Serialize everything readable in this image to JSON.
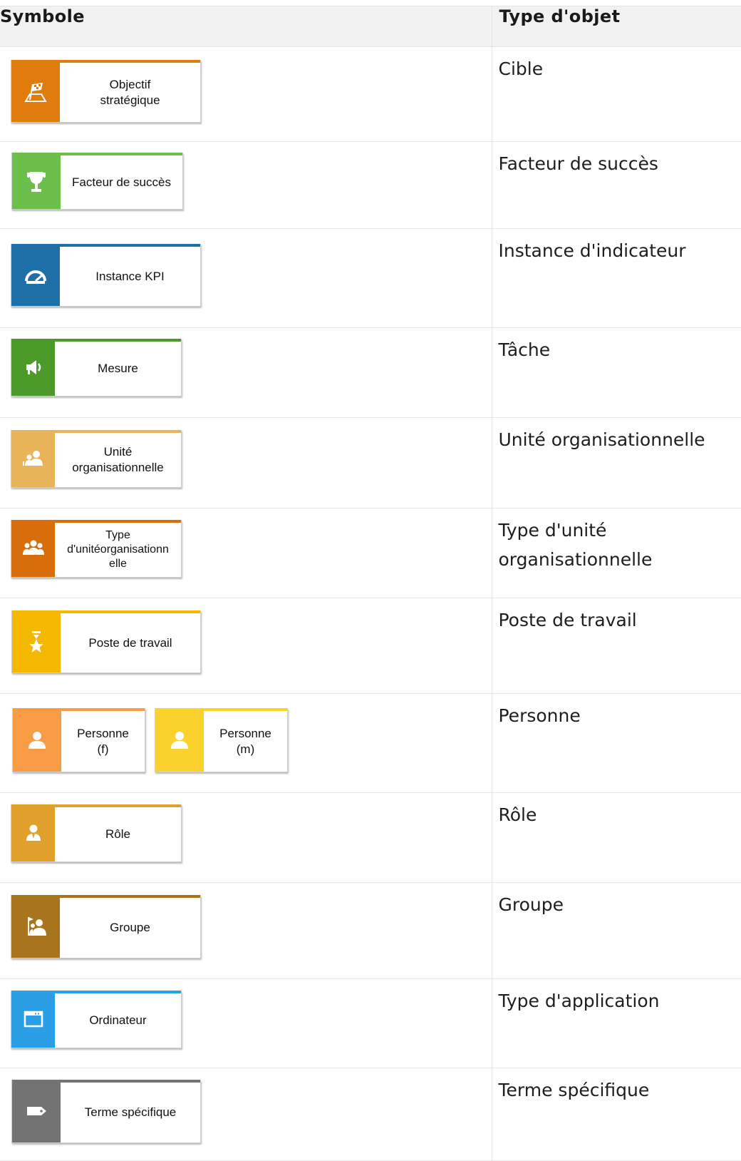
{
  "header": {
    "col_symbol": "Symbole",
    "col_type": "Type d'objet"
  },
  "rows": [
    {
      "symbols": [
        {
          "label": "Objectif\nstratégique",
          "icon": "flag-target-icon",
          "color": "#e07b0e"
        }
      ],
      "type": "Cible"
    },
    {
      "symbols": [
        {
          "label": "Facteur de succès",
          "icon": "trophy-icon",
          "color": "#6cbf4a"
        }
      ],
      "type": "Facteur de succès"
    },
    {
      "symbols": [
        {
          "label": "Instance KPI",
          "icon": "gauge-icon",
          "color": "#1f6fa8"
        }
      ],
      "type": "Instance d'indicateur"
    },
    {
      "symbols": [
        {
          "label": "Mesure",
          "icon": "megaphone-icon",
          "color": "#4c9a2a"
        }
      ],
      "type": "Tâche"
    },
    {
      "symbols": [
        {
          "label": "Unité\norganisationnelle",
          "icon": "org-unit-icon",
          "color": "#e8b45a"
        }
      ],
      "type": "Unité organisationnelle"
    },
    {
      "symbols": [
        {
          "label": "Type\nd'unitéorganisationn\nelle",
          "icon": "org-unit-type-icon",
          "color": "#d86e0b"
        }
      ],
      "type": "Type d'unité organisationnelle"
    },
    {
      "symbols": [
        {
          "label": "Poste de travail",
          "icon": "position-star-icon",
          "color": "#f5b800"
        }
      ],
      "type": "Poste de travail"
    },
    {
      "symbols": [
        {
          "label": "Personne\n(f)",
          "icon": "person-icon",
          "color": "#f79c45"
        },
        {
          "label": "Personne\n(m)",
          "icon": "person-icon",
          "color": "#fbd12e"
        }
      ],
      "type": "Personne"
    },
    {
      "symbols": [
        {
          "label": "Rôle",
          "icon": "role-icon",
          "color": "#e0a02b"
        }
      ],
      "type": "Rôle"
    },
    {
      "symbols": [
        {
          "label": "Groupe",
          "icon": "group-icon",
          "color": "#a8741d"
        }
      ],
      "type": "Groupe"
    },
    {
      "symbols": [
        {
          "label": "Ordinateur",
          "icon": "window-icon",
          "color": "#2b9ee6"
        }
      ],
      "type": "Type d'application"
    },
    {
      "symbols": [
        {
          "label": "Terme spécifique",
          "icon": "tag-icon",
          "color": "#737373"
        }
      ],
      "type": "Terme spécifique"
    }
  ]
}
